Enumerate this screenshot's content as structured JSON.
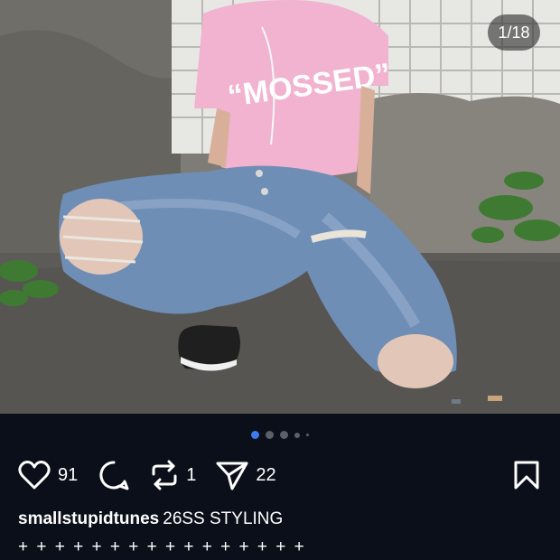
{
  "photo": {
    "page_counter": "1/18",
    "shirt_text": "“MOSSED”"
  },
  "carousel": {
    "total_indicators": 5,
    "active_index": 0
  },
  "actions": {
    "like_count": "91",
    "repost_count": "1",
    "share_count": "22"
  },
  "caption": {
    "username": "smallstupidtunes",
    "text": "26SS STYLING",
    "second_line": "+ + + + + + + + + + + + + + + +"
  },
  "colors": {
    "background": "#0b0f1a",
    "active_dot": "#3d7bf0",
    "inactive_dot": "#5b5f68",
    "text": "#ffffff"
  },
  "icons": {
    "like": "heart-icon",
    "comment": "comment-bubble-icon",
    "repost": "repost-arrows-icon",
    "share": "send-paper-plane-icon",
    "save": "bookmark-icon"
  }
}
